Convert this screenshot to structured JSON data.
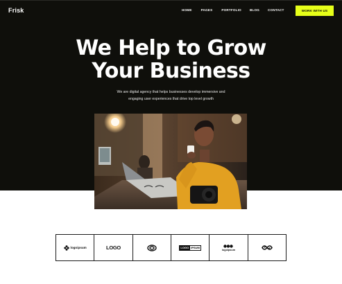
{
  "brand": {
    "name": "Frisk"
  },
  "nav": {
    "items": [
      "HOME",
      "PAGES",
      "PORTFOLIO",
      "BLOG",
      "CONTACT"
    ],
    "cta": "WORK WITH US"
  },
  "hero": {
    "title_line1": "We Help to Grow",
    "title_line2": "Your Business",
    "subtitle_line1": "We are digital agency that helps businesses develop immersive and",
    "subtitle_line2": "engaging user experiences that drive top level growth"
  },
  "clients": {
    "logos": [
      {
        "icon": "flower-icon",
        "label": "logoipsum"
      },
      {
        "icon": "none",
        "label": "LOGO"
      },
      {
        "icon": "ring-icon",
        "label": ""
      },
      {
        "icon": "none",
        "label_left": "LOGO",
        "label_right": "IPSUM"
      },
      {
        "icon": "dots-icon",
        "label": "logoipsum"
      },
      {
        "icon": "infinity-icon",
        "label": ""
      }
    ]
  },
  "colors": {
    "hero_bg": "#0f0f0b",
    "accent": "#e6ff19",
    "text_light": "#ffffff"
  }
}
